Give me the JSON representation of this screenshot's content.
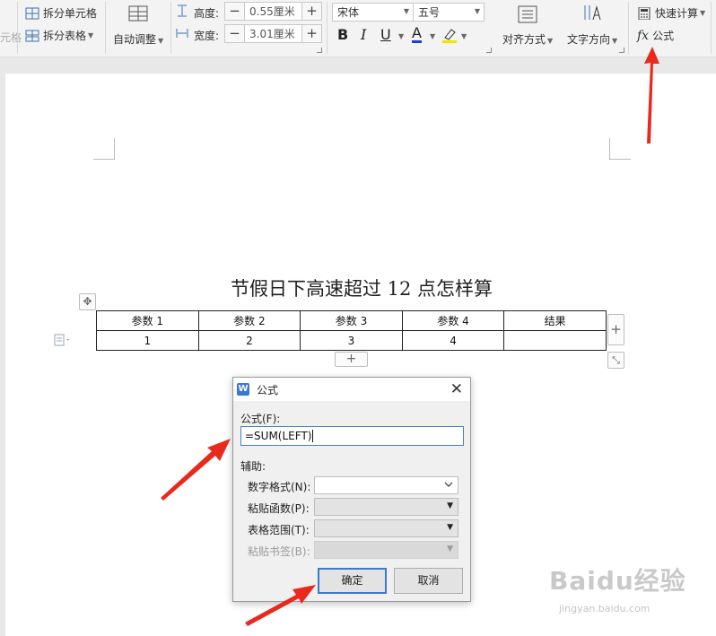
{
  "ribbon": {
    "left_partial": "元格",
    "split_cell": "拆分单元格",
    "split_table": "拆分表格",
    "auto_adjust": "自动调整",
    "height_label": "高度:",
    "height_value": "0.55厘米",
    "width_label": "宽度:",
    "width_value": "3.01厘米",
    "font_name": "宋体",
    "font_size": "五号",
    "bold": "B",
    "italic": "I",
    "underline": "U",
    "font_color": "A",
    "align": "对齐方式",
    "text_direction": "文字方向",
    "quick_calc": "快速计算",
    "formula_icon": "fx",
    "formula": "公式"
  },
  "document": {
    "title": "节假日下高速超过 12 点怎样算",
    "table": {
      "headers": [
        "参数 1",
        "参数 2",
        "参数 3",
        "参数 4",
        "结果"
      ],
      "rows": [
        [
          "1",
          "2",
          "3",
          "4",
          ""
        ]
      ]
    },
    "add_col": "+",
    "add_row": "+"
  },
  "dialog": {
    "logo": "W",
    "title": "公式",
    "close": "✕",
    "formula_label": "公式(F):",
    "formula_value": "=SUM(LEFT)",
    "aux_label": "辅助:",
    "number_format_label": "数字格式(N):",
    "paste_function_label": "粘贴函数(P):",
    "table_range_label": "表格范围(T):",
    "paste_bookmark_label": "粘贴书签(B):",
    "ok": "确定",
    "cancel": "取消"
  },
  "watermark": {
    "brand": "Baidu经验",
    "url": "jingyan.baidu.com"
  },
  "colors": {
    "accent": "#3a78d6",
    "arrow": "#e8291c",
    "font_color_bar": "#1f3fcc",
    "highlight_bar": "#f5e400"
  }
}
